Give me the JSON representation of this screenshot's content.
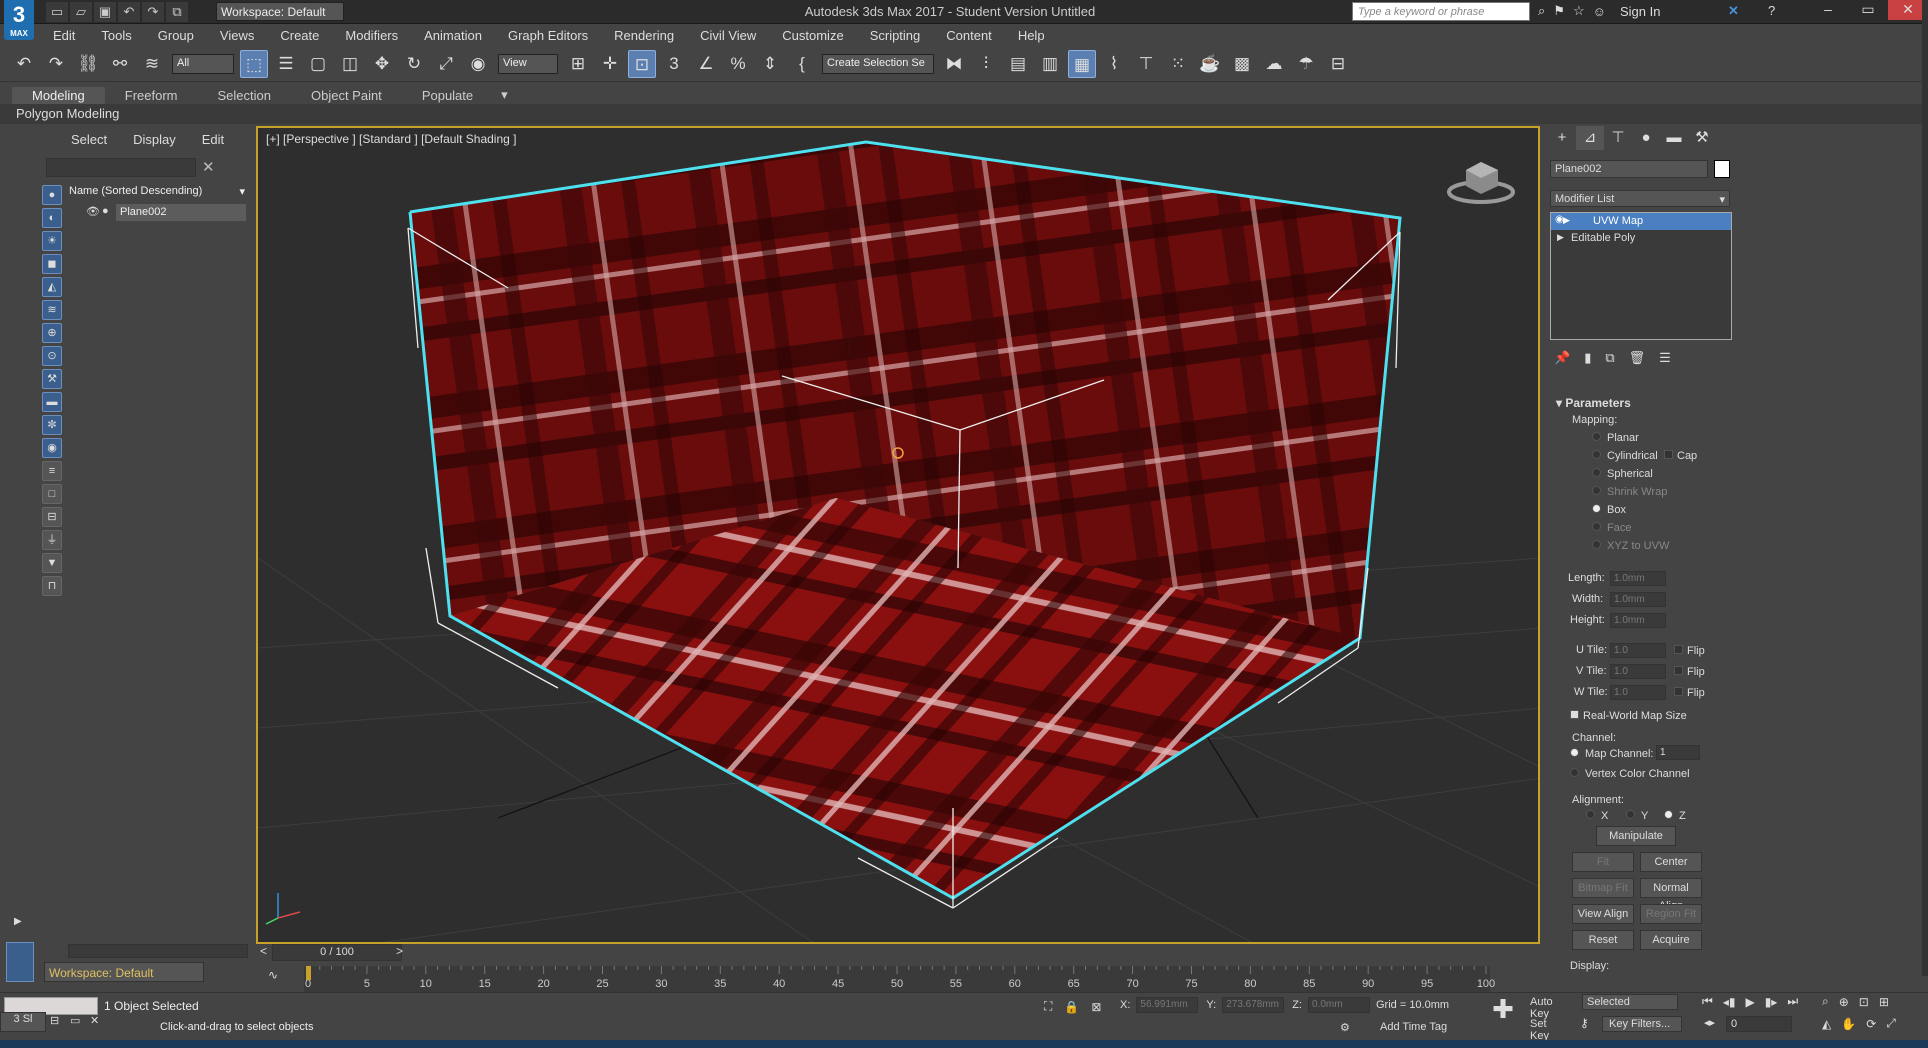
{
  "app": {
    "logo": "3",
    "logo_sub": "MAX",
    "title": "Autodesk 3ds Max 2017 - Student Version    Untitled",
    "workspace": "Workspace: Default",
    "search_placeholder": "Type a keyword or phrase",
    "signin": "Sign In"
  },
  "menu": [
    "Edit",
    "Tools",
    "Group",
    "Views",
    "Create",
    "Modifiers",
    "Animation",
    "Graph Editors",
    "Rendering",
    "Civil View",
    "Customize",
    "Scripting",
    "Content",
    "Help"
  ],
  "toolbar": {
    "filter": "All",
    "ref_coord": "View",
    "selection_set": "Create Selection Se"
  },
  "ribbon": {
    "tabs": [
      "Modeling",
      "Freeform",
      "Selection",
      "Object Paint",
      "Populate"
    ],
    "active": "Modeling",
    "sub": "Polygon Modeling"
  },
  "scene_explorer": {
    "tabs": [
      "Select",
      "Display",
      "Edit"
    ],
    "column_header": "Name (Sorted Descending)",
    "objects": [
      "Plane002"
    ]
  },
  "viewport": {
    "label": "[+] [Perspective ] [Standard ] [Default Shading ]"
  },
  "command_panel": {
    "object_name": "Plane002",
    "modifier_list": "Modifier List",
    "stack": [
      "UVW Map",
      "Editable Poly"
    ],
    "params": {
      "title": "Parameters",
      "mapping_label": "Mapping:",
      "mapping_options": [
        "Planar",
        "Cylindrical",
        "Spherical",
        "Shrink Wrap",
        "Box",
        "Face",
        "XYZ to UVW"
      ],
      "cap": "Cap",
      "length_label": "Length:",
      "width_label": "Width:",
      "height_label": "Height:",
      "length": "1.0mm",
      "width": "1.0mm",
      "height": "1.0mm",
      "utile_label": "U Tile:",
      "vtile_label": "V Tile:",
      "wtile_label": "W Tile:",
      "utile": "1.0",
      "vtile": "1.0",
      "wtile": "1.0",
      "flip": "Flip",
      "realworld": "Real-World Map Size",
      "channel_label": "Channel:",
      "map_channel": "Map Channel:",
      "map_channel_value": "1",
      "vertex_color": "Vertex Color Channel",
      "alignment_label": "Alignment:",
      "x": "X",
      "y": "Y",
      "z": "Z",
      "manipulate": "Manipulate",
      "fit": "Fit",
      "center": "Center",
      "bitmap_fit": "Bitmap Fit",
      "normal_align": "Normal Align",
      "view_align": "View Align",
      "region_fit": "Region Fit",
      "reset": "Reset",
      "acquire": "Acquire",
      "display_label": "Display:"
    }
  },
  "timeline": {
    "frame": "0 / 100",
    "ticks": [
      "0",
      "5",
      "10",
      "15",
      "20",
      "25",
      "30",
      "35",
      "40",
      "45",
      "50",
      "55",
      "60",
      "65",
      "70",
      "75",
      "80",
      "85",
      "90",
      "95",
      "100"
    ]
  },
  "status": {
    "selected": "1 Object Selected",
    "prompt": "Click-and-drag to select objects",
    "x_label": "X:",
    "x": "56.991mm",
    "y_label": "Y:",
    "y": "273.678mm",
    "z_label": "Z:",
    "z": "0.0mm",
    "grid": "Grid = 10.0mm",
    "add_time_tag": "Add Time Tag",
    "auto_key": "Auto Key",
    "set_key": "Set Key",
    "selected_dd": "Selected",
    "key_filters": "Key Filters...",
    "frame_field": "0"
  }
}
